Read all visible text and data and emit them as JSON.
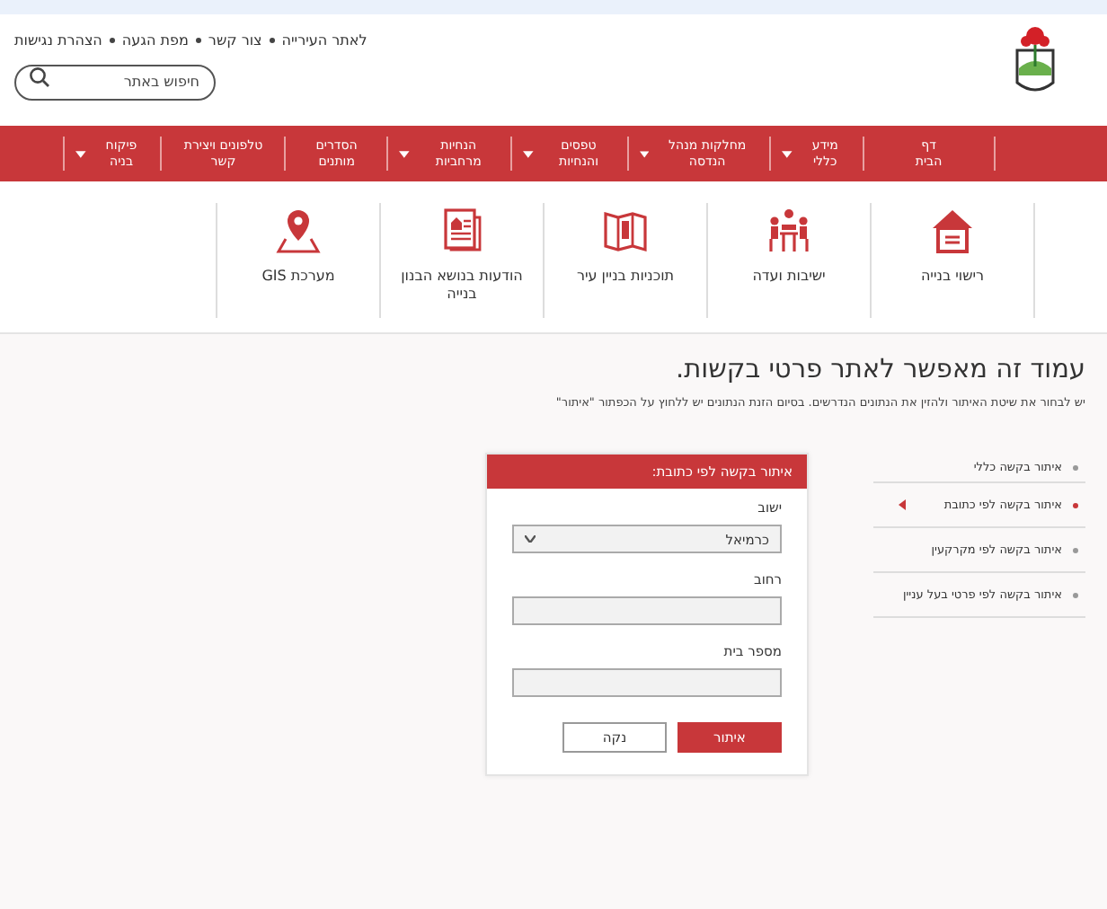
{
  "header": {
    "top_links": [
      "לאתר העירייה",
      "צור קשר",
      "מפת הגעה",
      "הצהרת נגישות"
    ],
    "search": {
      "placeholder": "חיפוש באתר"
    }
  },
  "nav": [
    {
      "label": "דף הבית",
      "has_menu": false
    },
    {
      "label": "מידע כללי",
      "has_menu": true
    },
    {
      "label": "מחלקות מנהל הנדסה",
      "has_menu": true
    },
    {
      "label": "טפסים והנחיות",
      "has_menu": true
    },
    {
      "label": "הנחיות מרחביות",
      "has_menu": true
    },
    {
      "label": "הסדרים מותנים",
      "has_menu": false
    },
    {
      "label": "טלפונים ויצירת קשר",
      "has_menu": false
    },
    {
      "label": "פיקוח בניה",
      "has_menu": true
    }
  ],
  "quick_links": [
    {
      "kind": "house",
      "label": "רישוי בנייה"
    },
    {
      "kind": "meeting",
      "label": "ישיבות ועדה"
    },
    {
      "kind": "map",
      "label": "תוכניות בניין עיר"
    },
    {
      "kind": "document",
      "label": "הודעות בנושא הבנון בנייה"
    },
    {
      "kind": "pin",
      "label": "מערכת GIS"
    }
  ],
  "page": {
    "title": "עמוד זה מאפשר לאתר פרטי בקשות.",
    "intro": "יש לבחור את שיטת האיתור ולהזין את הנתונים הנדרשים. בסיום הזנת הנתונים יש ללחוץ על הכפתור \"איתור\""
  },
  "side_menu": [
    {
      "label": "איתור בקשה כללי",
      "selected": false
    },
    {
      "label": "איתור בקשה לפי כתובת",
      "selected": true
    },
    {
      "label": "איתור בקשה לפי מקרקעין",
      "selected": false
    },
    {
      "label": "איתור בקשה לפי פרטי בעל עניין",
      "selected": false
    }
  ],
  "form": {
    "title": "איתור בקשה לפי כתובת:",
    "fields": [
      {
        "kind": "select",
        "label": "ישוב",
        "value": "כרמיאל"
      },
      {
        "kind": "text",
        "label": "רחוב"
      },
      {
        "kind": "text",
        "label": "מספר בית"
      }
    ],
    "buttons": [
      {
        "kind": "primary",
        "label": "איתור"
      },
      {
        "kind": "secondary",
        "label": "נקה"
      }
    ]
  }
}
